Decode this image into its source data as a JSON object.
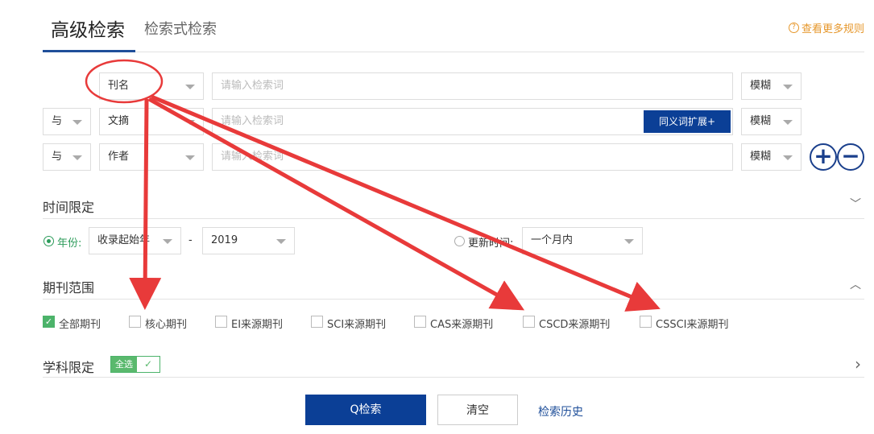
{
  "tabs": {
    "active": "高级检索",
    "other": "检索式检索",
    "rules_link": "查看更多规则",
    "help_glyph": "?"
  },
  "rows": [
    {
      "field": "刊名",
      "placeholder": "请输入检索词",
      "match": "模糊"
    },
    {
      "logic": "与",
      "field": "文摘",
      "placeholder": "请输入检索词",
      "match": "模糊",
      "synonym_button": "同义词扩展+"
    },
    {
      "logic": "与",
      "field": "作者",
      "placeholder": "请输入检索词",
      "match": "模糊"
    }
  ],
  "row_controls": {
    "add": "+",
    "remove": "−"
  },
  "time": {
    "title": "时间限定",
    "year_label": "年份:",
    "year_from": "收录起始年",
    "dash": "-",
    "year_to": "2019",
    "update_label": "更新时间:",
    "update_value": "一个月内"
  },
  "journal": {
    "title": "期刊范围",
    "options": [
      {
        "label": "全部期刊",
        "checked": true
      },
      {
        "label": "核心期刊",
        "checked": false
      },
      {
        "label": "EI来源期刊",
        "checked": false
      },
      {
        "label": "SCI来源期刊",
        "checked": false
      },
      {
        "label": "CAS来源期刊",
        "checked": false
      },
      {
        "label": "CSCD来源期刊",
        "checked": false
      },
      {
        "label": "CSSCI来源期刊",
        "checked": false
      }
    ]
  },
  "subject": {
    "title": "学科限定",
    "all_select": "全选",
    "check_glyph": "✓"
  },
  "actions": {
    "search": "Q检索",
    "clear": "清空",
    "history": "检索历史"
  },
  "toggles": {
    "time": "﹀",
    "journal": "︿",
    "subject": "›"
  },
  "colors": {
    "primary": "#0b3f96",
    "accent_orange": "#e6972b",
    "check_green": "#4cb36a",
    "annotation_red": "#e83a3a"
  }
}
